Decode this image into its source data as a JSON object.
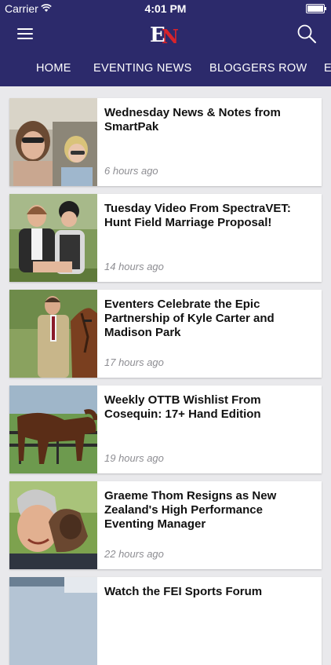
{
  "status_bar": {
    "carrier": "Carrier",
    "time": "4:01 PM"
  },
  "header": {
    "logo_text": "EN"
  },
  "tabs": [
    {
      "label": "HOME"
    },
    {
      "label": "EVENTING NEWS"
    },
    {
      "label": "BLOGGERS ROW"
    },
    {
      "label": "E"
    }
  ],
  "articles": [
    {
      "title": "Wednesday News & Notes from SmartPak",
      "time": "6 hours ago"
    },
    {
      "title": "Tuesday Video From SpectraVET: Hunt Field Marriage Proposal!",
      "time": "14 hours ago"
    },
    {
      "title": "Eventers Celebrate the Epic Partnership of Kyle Carter and Madison Park",
      "time": "17 hours ago"
    },
    {
      "title": "Weekly OTTB Wishlist From Cosequin: 17+ Hand Edition",
      "time": "19 hours ago"
    },
    {
      "title": "Graeme Thom Resigns as New Zealand's High Performance Eventing Manager",
      "time": "22 hours ago"
    },
    {
      "title": "Watch the FEI Sports Forum",
      "time": ""
    }
  ],
  "colors": {
    "brand": "#2c2a6b",
    "accent": "#d8232a",
    "background": "#e9e9ec"
  }
}
